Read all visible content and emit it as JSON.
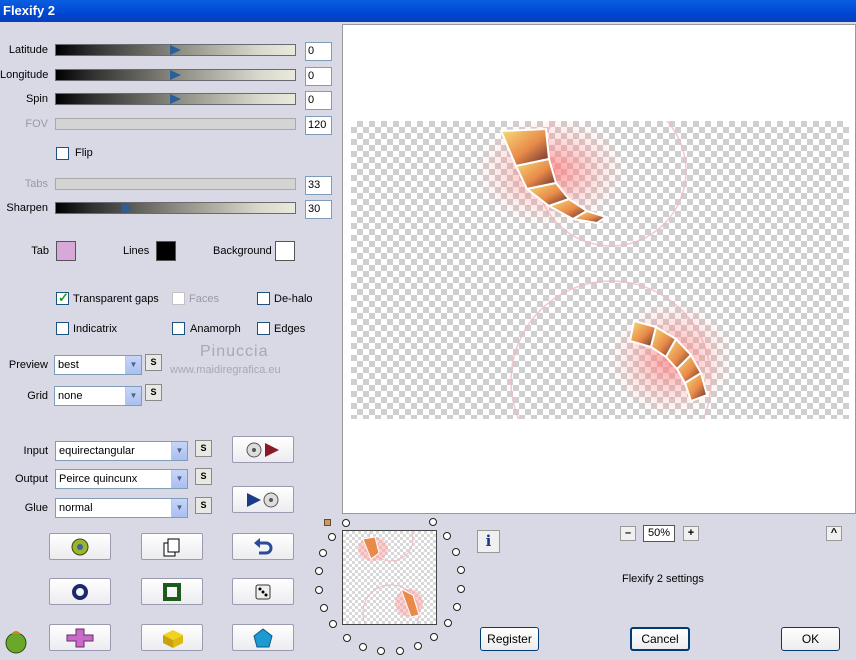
{
  "window": {
    "title": "Flexify 2"
  },
  "sliders": {
    "latitude": {
      "label": "Latitude",
      "value": "0",
      "level": 0.5
    },
    "longitude": {
      "label": "Longitude",
      "value": "0",
      "level": 0.5
    },
    "spin": {
      "label": "Spin",
      "value": "0",
      "level": 0.5
    },
    "fov": {
      "label": "FOV",
      "value": "120",
      "disabled": true
    },
    "tabs": {
      "label": "Tabs",
      "value": "33",
      "disabled": true
    },
    "sharpen": {
      "label": "Sharpen",
      "value": "30",
      "level": 0.3
    }
  },
  "flip": {
    "label": "Flip",
    "checked": false
  },
  "colors": {
    "tab": {
      "label": "Tab",
      "color": "#d8a8d8"
    },
    "lines": {
      "label": "Lines",
      "color": "#000000"
    },
    "background": {
      "label": "Background",
      "color": "#ffffff"
    }
  },
  "options": {
    "transparent_gaps": {
      "label": "Transparent gaps",
      "checked": true
    },
    "faces": {
      "label": "Faces",
      "checked": false,
      "disabled": true
    },
    "de_halo": {
      "label": "De-halo",
      "checked": false
    },
    "indicatrix": {
      "label": "Indicatrix",
      "checked": false
    },
    "anamorph": {
      "label": "Anamorph",
      "checked": false
    },
    "edges": {
      "label": "Edges",
      "checked": false
    }
  },
  "selects": {
    "preview": {
      "label": "Preview",
      "value": "best"
    },
    "grid": {
      "label": "Grid",
      "value": "none"
    },
    "input": {
      "label": "Input",
      "value": "equirectangular"
    },
    "output": {
      "label": "Output",
      "value": "Peirce quincunx"
    },
    "glue": {
      "label": "Glue",
      "value": "normal"
    }
  },
  "s_button_label": "S",
  "watermark": {
    "name": "Pinuccia",
    "site": "www.maidiregrafica.eu"
  },
  "zoom": {
    "minus": "–",
    "value": "50%",
    "plus": "+",
    "up": "^"
  },
  "settings_label": "Flexify 2 settings",
  "info_label": "i",
  "buttons": {
    "register": "Register",
    "cancel": "Cancel",
    "ok": "OK"
  },
  "accent": {
    "title_bar": "#0a5ee0",
    "thumb": "#2b5f9a"
  }
}
